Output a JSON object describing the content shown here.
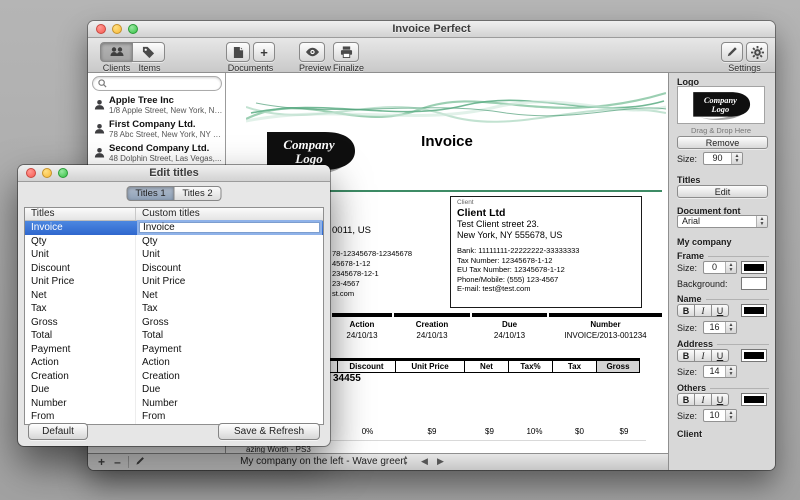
{
  "colors": {
    "selection_blue": "#3b78dd",
    "wave_green": "#7cc49e",
    "rule_green": "#3d8b65",
    "logo_black": "#101010"
  },
  "window": {
    "title": "Invoice Perfect"
  },
  "toolbar": {
    "clients_label": "Clients",
    "items_label": "Items",
    "documents_label": "Documents",
    "preview_label": "Preview",
    "finalize_label": "Finalize",
    "settings_label": "Settings"
  },
  "sidebar": {
    "clients": [
      {
        "name": "Apple Tree Inc",
        "address": "1/8 Apple Street, New York, NY..."
      },
      {
        "name": "First Company Ltd.",
        "address": "78 Abc Street, New York, NY 1..."
      },
      {
        "name": "Second Company Ltd.",
        "address": "48 Dolphin Street, Las Vegas,..."
      }
    ]
  },
  "invoice": {
    "title": "Invoice",
    "logo_line1": "Company",
    "logo_line2": "Logo",
    "client_box": {
      "label": "Client",
      "name": "Client Ltd",
      "address1": "Test Client street 23.",
      "address2": "New York, NY 555678, US",
      "details": [
        "Bank: 11111111-22222222-33333333",
        "Tax Number: 12345678-1-12",
        "EU Tax Number: 12345678-1-12",
        "Phone/Mobile: (555) 123-4567",
        "E-mail: test@test.com"
      ]
    },
    "company_fragments": [
      "0011, US",
      "78-12345678-12345678",
      "45678-1-12",
      "2345678-12-1",
      "23-4567",
      "st.com"
    ],
    "meta": {
      "headers": [
        "Action",
        "Creation",
        "Due",
        "Number"
      ],
      "values": [
        "24/10/13",
        "24/10/13",
        "24/10/13",
        "INVOICE/2013-001234"
      ]
    },
    "items": {
      "headers": [
        "Discount",
        "Unit Price",
        "Net",
        "Tax%",
        "Tax",
        "Gross"
      ],
      "row": [
        "0%",
        "$9",
        "$9",
        "10%",
        "$0",
        "$9"
      ],
      "code_fragment": "34455",
      "name_fragment": "azing Worth - PS3"
    }
  },
  "settings": {
    "logo_section": {
      "title": "Logo",
      "drop_hint": "Drag & Drop Here",
      "remove_label": "Remove",
      "size_label": "Size:",
      "size_value": "90"
    },
    "titles_section": {
      "title": "Titles",
      "edit_label": "Edit"
    },
    "font_section": {
      "title": "Document font",
      "value": "Arial"
    },
    "company_section": {
      "title": "My company",
      "frame": {
        "title": "Frame",
        "size_label": "Size:",
        "size_value": "0",
        "background_label": "Background:"
      },
      "name": {
        "title": "Name",
        "size_label": "Size:",
        "size_value": "16"
      },
      "address": {
        "title": "Address",
        "size_label": "Size:",
        "size_value": "14"
      },
      "others": {
        "title": "Others",
        "size_label": "Size:",
        "size_value": "10"
      }
    },
    "client_section": {
      "title": "Client"
    },
    "style_buttons": {
      "bold": "B",
      "italic": "I",
      "underline": "U"
    }
  },
  "bottom_bar": {
    "template_label": "My company on the left - Wave green"
  },
  "dialog": {
    "title": "Edit titles",
    "tabs": [
      "Titles 1",
      "Titles 2"
    ],
    "columns": [
      "Titles",
      "Custom titles"
    ],
    "rows": [
      {
        "title": "Invoice",
        "custom": "Invoice"
      },
      {
        "title": "Qty",
        "custom": "Qty"
      },
      {
        "title": "Unit",
        "custom": "Unit"
      },
      {
        "title": "Discount",
        "custom": "Discount"
      },
      {
        "title": "Unit Price",
        "custom": "Unit Price"
      },
      {
        "title": "Net",
        "custom": "Net"
      },
      {
        "title": "Tax",
        "custom": "Tax"
      },
      {
        "title": "Gross",
        "custom": "Gross"
      },
      {
        "title": "Total",
        "custom": "Total"
      },
      {
        "title": "Payment",
        "custom": "Payment"
      },
      {
        "title": "Action",
        "custom": "Action"
      },
      {
        "title": "Creation",
        "custom": "Creation"
      },
      {
        "title": "Due",
        "custom": "Due"
      },
      {
        "title": "Number",
        "custom": "Number"
      },
      {
        "title": "From",
        "custom": "From"
      }
    ],
    "default_label": "Default",
    "save_label": "Save & Refresh"
  }
}
